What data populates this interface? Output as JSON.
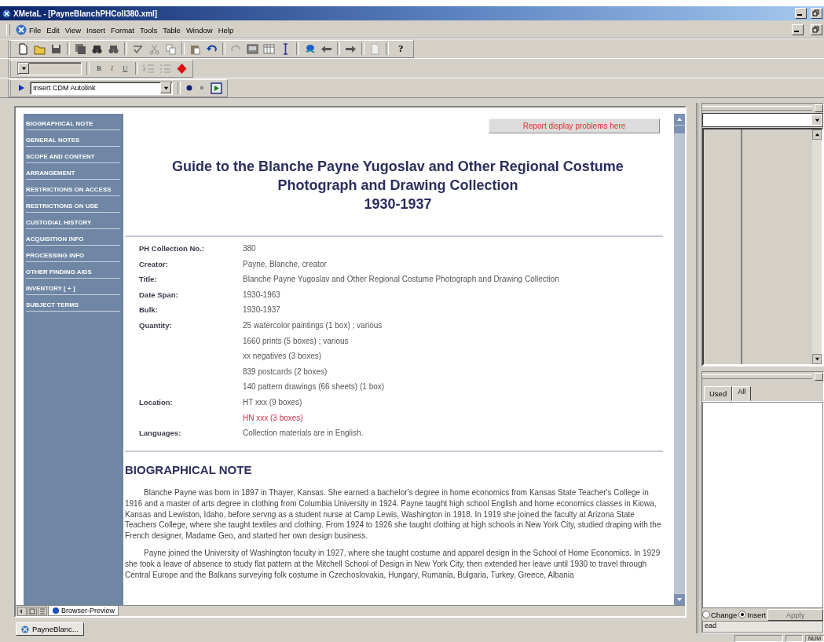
{
  "window": {
    "title": "XMetaL - [PayneBlanchPHColl380.xml]"
  },
  "menu": [
    "File",
    "Edit",
    "View",
    "Insert",
    "Format",
    "Tools",
    "Table",
    "Window",
    "Help"
  ],
  "format_toolbar": {
    "bold": "B",
    "italic": "I",
    "underline": "U"
  },
  "help_button": "?",
  "autolink": {
    "value": "Insert CDM Autolink"
  },
  "nav": [
    "BIOGRAPHICAL NOTE",
    "GENERAL NOTES",
    "SCOPE AND CONTENT",
    "ARRANGEMENT",
    "RESTRICTIONS ON ACCESS",
    "RESTRICTIONS ON USE",
    "CUSTODIAL HISTORY",
    "ACQUISITION INFO",
    "PROCESSING INFO",
    "OTHER FINDING AIDS",
    "INVENTORY  [ + ]",
    "SUBJECT TERMS"
  ],
  "report_button": "Report display problems here",
  "title_lines": [
    "Guide to the Blanche Payne Yugoslav and Other Regional Costume",
    "Photograph and Drawing Collection",
    "1930-1937"
  ],
  "details": [
    {
      "label": "PH Collection No.:",
      "values": [
        {
          "text": "380",
          "highlighted": false
        }
      ]
    },
    {
      "label": "Creator:",
      "values": [
        {
          "text": "Payne, Blanche, creator",
          "highlighted": false
        }
      ]
    },
    {
      "label": "Title:",
      "values": [
        {
          "text": "Blanche Payne Yugoslav and Other Regional Costume Photograph and Drawing Collection",
          "highlighted": false
        }
      ]
    },
    {
      "label": "Date Span:",
      "values": [
        {
          "text": "1930-1963",
          "highlighted": false
        }
      ]
    },
    {
      "label": "Bulk:",
      "values": [
        {
          "text": "1930-1937",
          "highlighted": false
        }
      ]
    },
    {
      "label": "Quantity:",
      "values": [
        {
          "text": "25 watercolor paintings (1 box) ; various",
          "highlighted": false
        },
        {
          "text": "1660 prints (5 boxes) ; various",
          "highlighted": false
        },
        {
          "text": "xx negatives (3 boxes)",
          "highlighted": false
        },
        {
          "text": "839 postcards (2 boxes)",
          "highlighted": false
        },
        {
          "text": "140 pattern drawings (66 sheets) (1 box)",
          "highlighted": false
        }
      ]
    },
    {
      "label": "Location:",
      "values": [
        {
          "text": "HT xxx (9 boxes)",
          "highlighted": false
        },
        {
          "text": "HN xxx (3 boxes)",
          "highlighted": true
        }
      ]
    },
    {
      "label": "Languages:",
      "values": [
        {
          "text": "Collection materials are in English.",
          "highlighted": false
        }
      ]
    }
  ],
  "section": {
    "heading": "BIOGRAPHICAL NOTE",
    "paragraphs": [
      "Blanche Payne was born in 1897 in Thayer, Kansas. She earned a bachelor's degree in home economics from Kansas State Teacher's College in 1916 and a master of arts degree in clothing from Columbia University in 1924. Payne taught high school English and home economics classes in Kiowa, Kansas and Lewiston, Idaho, before servng as a student nurse at Camp Lewis, Washington in 1918. In 1919 she joined the faculty at Arizona State Teachers College, where she taught textiles and clothing. From 1924 to 1926 she taught clothing at high schools in New York City, studied draping with the French designer, Madame Geo, and started her own design business.",
      "Payne joined the University of Washington faculty in 1927, where she taught costume and apparel design in the School of Home Economics. In 1929 she took a leave of absence to study flat pattern at the Mitchell School of Design in New York City, then extended her leave until 1930 to travel through Central Europe and the Balkans surveying folk costume in Czechoslovakia, Hungary, Rumania, Bulgaria, Turkey, Greece, Albania"
    ]
  },
  "view_tabs": [
    {
      "label": "Browser-Preview",
      "selected": true
    }
  ],
  "doc_tabs": [
    {
      "label": "PayneBlanc...",
      "selected": true
    }
  ],
  "side_tabs": [
    {
      "label": "Used",
      "selected": false
    },
    {
      "label": "All",
      "selected": true
    }
  ],
  "insert_mode": [
    {
      "label": "Change",
      "selected": false
    },
    {
      "label": "Insert",
      "selected": true
    }
  ],
  "apply_button": {
    "label": "Apply",
    "disabled": true
  },
  "element_field": {
    "value": "ead"
  },
  "status_bar": {
    "num": "NUM"
  }
}
